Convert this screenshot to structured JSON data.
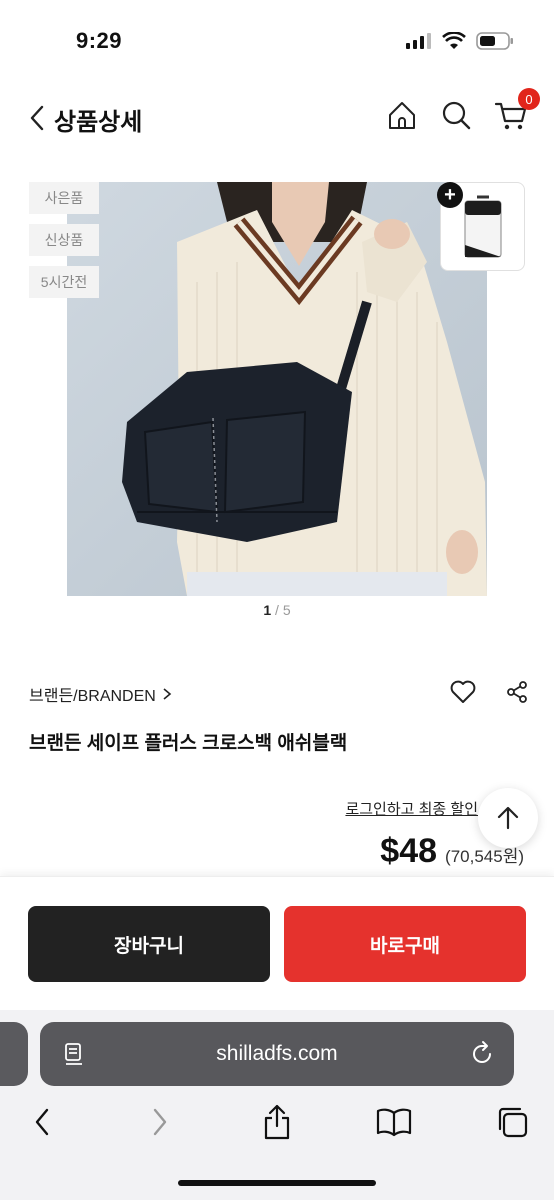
{
  "status_bar": {
    "time": "9:29"
  },
  "header": {
    "title": "상품상세",
    "cart_count": "0"
  },
  "product": {
    "tags": [
      "사은품",
      "신상품",
      "5시간전"
    ],
    "image_pager": {
      "current": "1",
      "total": "/ 5"
    },
    "brand": "브랜든/BRANDEN",
    "name": "브랜든 세이프 플러스 크로스백 애쉬블랙",
    "login_link": "로그인하고 최종 할인",
    "price_usd": "$48",
    "price_krw": "(70,545원)"
  },
  "buttons": {
    "cart": "장바구니",
    "buy": "바로구매"
  },
  "browser": {
    "url": "shilladfs.com"
  },
  "colors": {
    "accent": "#e5322d",
    "dark": "#222222"
  },
  "icons": [
    "back-icon",
    "home-icon",
    "search-icon",
    "cart-icon",
    "heart-icon",
    "share-icon",
    "arrow-up-icon",
    "reader-icon",
    "reload-icon",
    "share-ios-icon",
    "book-icon",
    "tabs-icon"
  ]
}
